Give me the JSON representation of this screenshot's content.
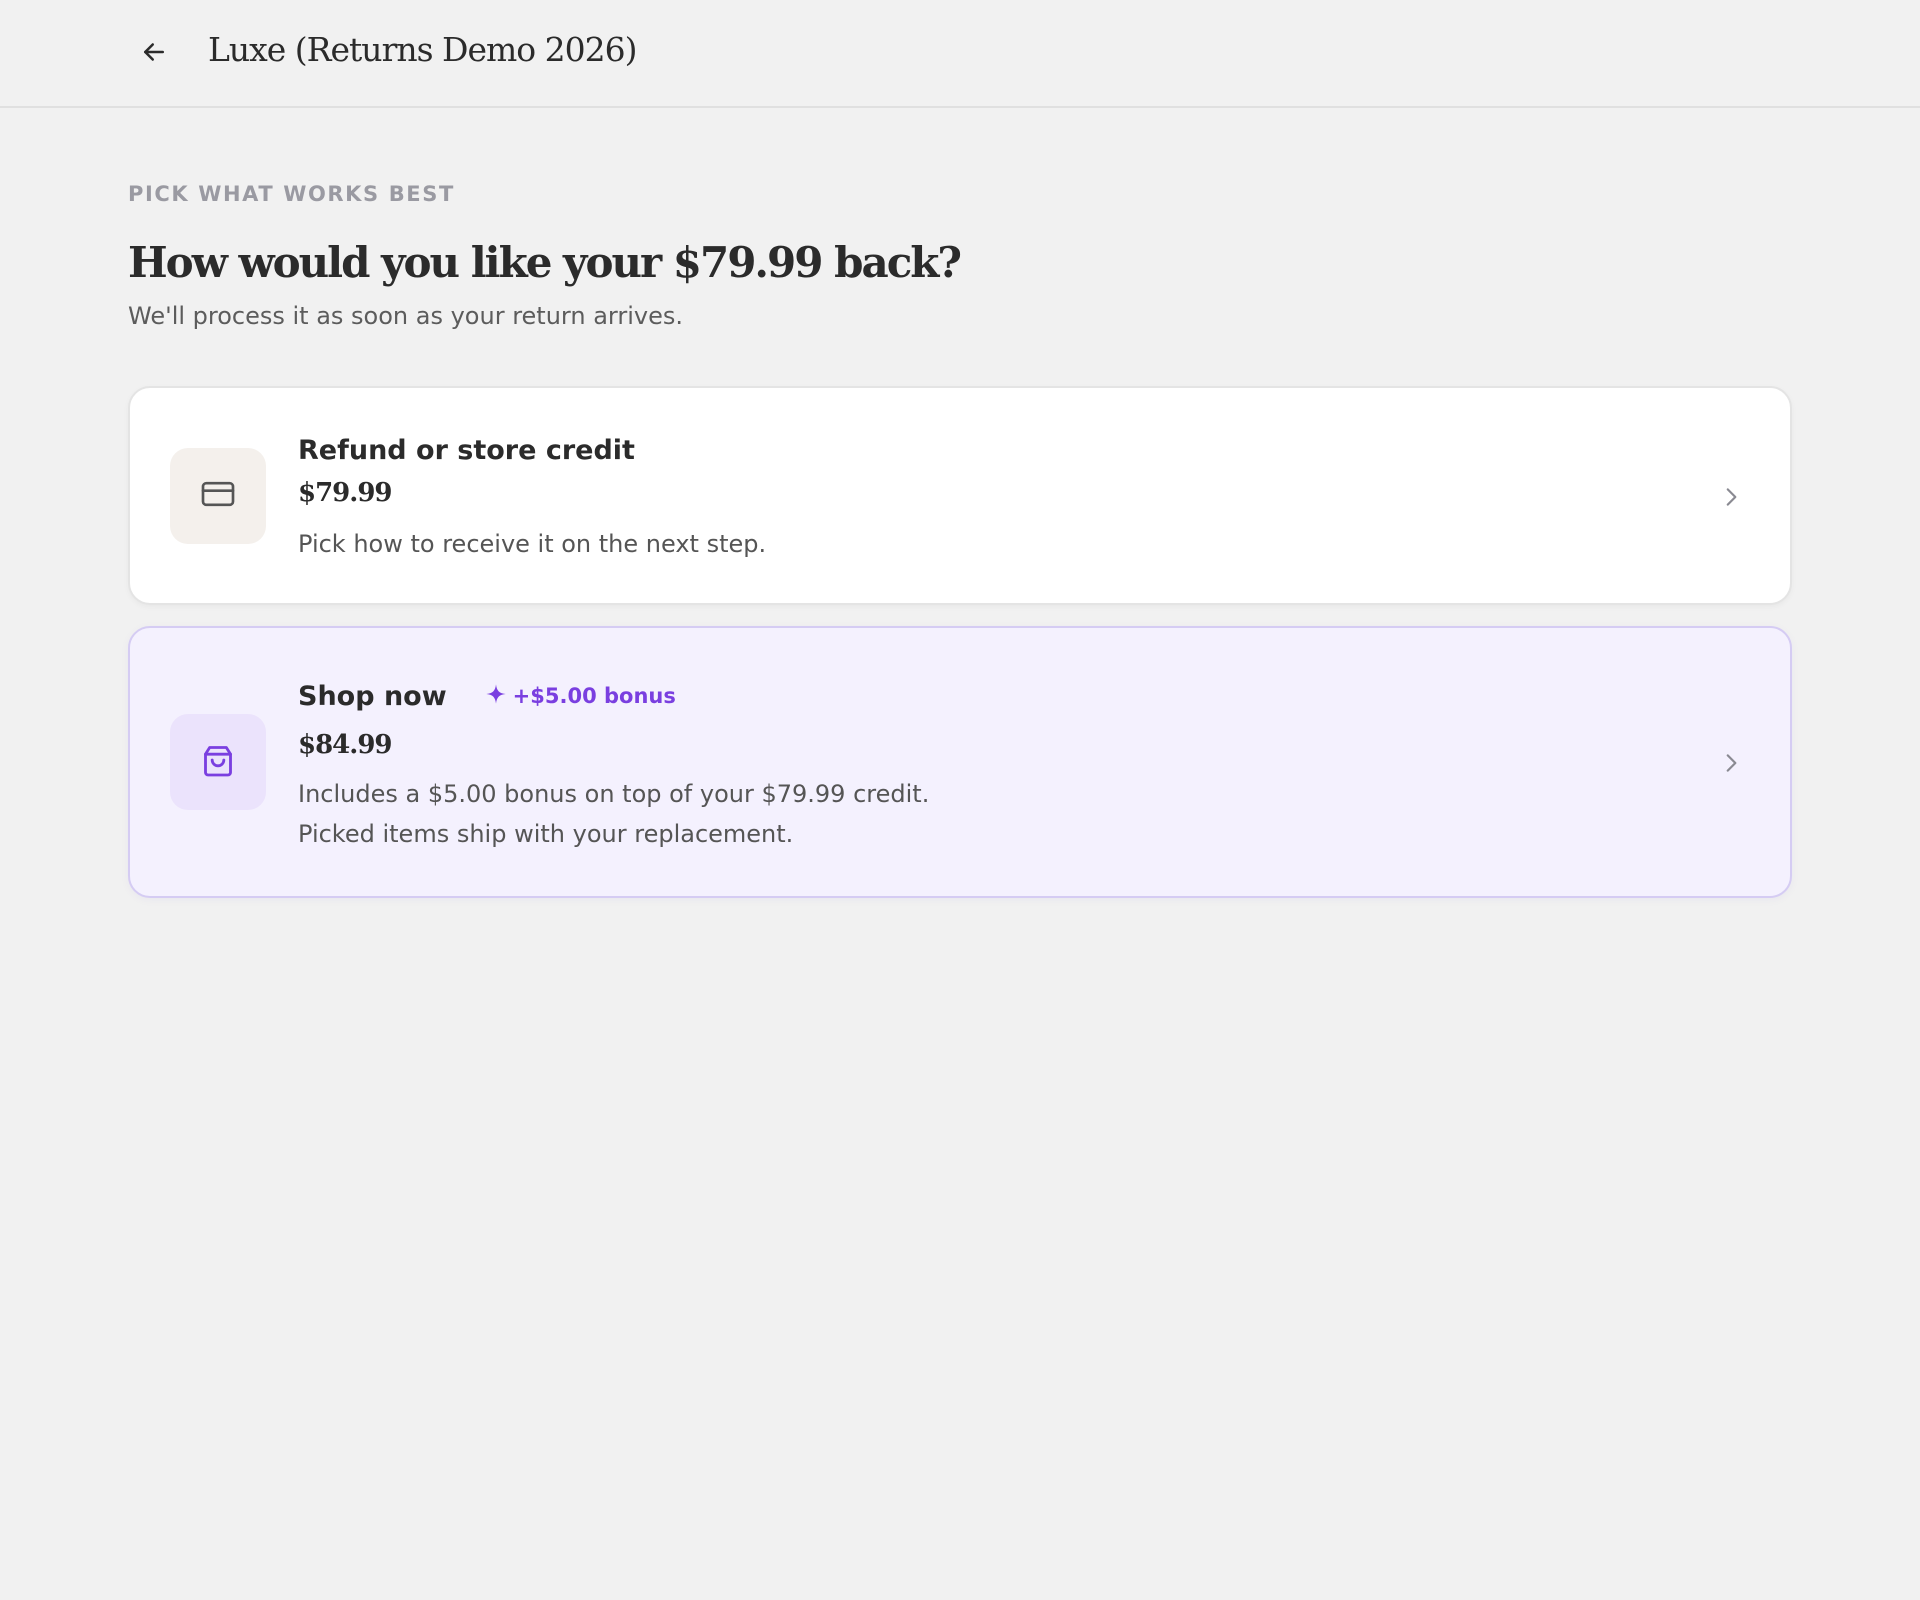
{
  "header": {
    "back_icon": "arrow-left-icon",
    "title": "Luxe (Returns Demo 2026)"
  },
  "main": {
    "eyebrow": "PICK WHAT WORKS BEST",
    "title": "How would you like your $79.99 back?",
    "subtitle": "We'll process it as soon as your return arrives."
  },
  "options": [
    {
      "icon": "credit-card-icon",
      "title": "Refund or store credit",
      "amount": "$79.99",
      "description_lines": [
        "Pick how to receive it on the next step."
      ],
      "chevron_icon": "chevron-right-icon",
      "colors": {
        "background": "#ffffff",
        "icon_tile": "#f4f0ec"
      }
    },
    {
      "icon": "shopping-bag-icon",
      "title": "Shop now",
      "badge": {
        "icon": "sparkle-icon",
        "label": "+$5.00 bonus"
      },
      "amount": "$84.99",
      "description_lines": [
        "Includes a $5.00 bonus on top of your $79.99 credit.",
        "Picked items ship with your replacement."
      ],
      "chevron_icon": "chevron-right-icon",
      "colors": {
        "background": "#f4f1fe",
        "icon_tile": "#ebe3fc",
        "accent": "#7a3fe0"
      }
    }
  ]
}
